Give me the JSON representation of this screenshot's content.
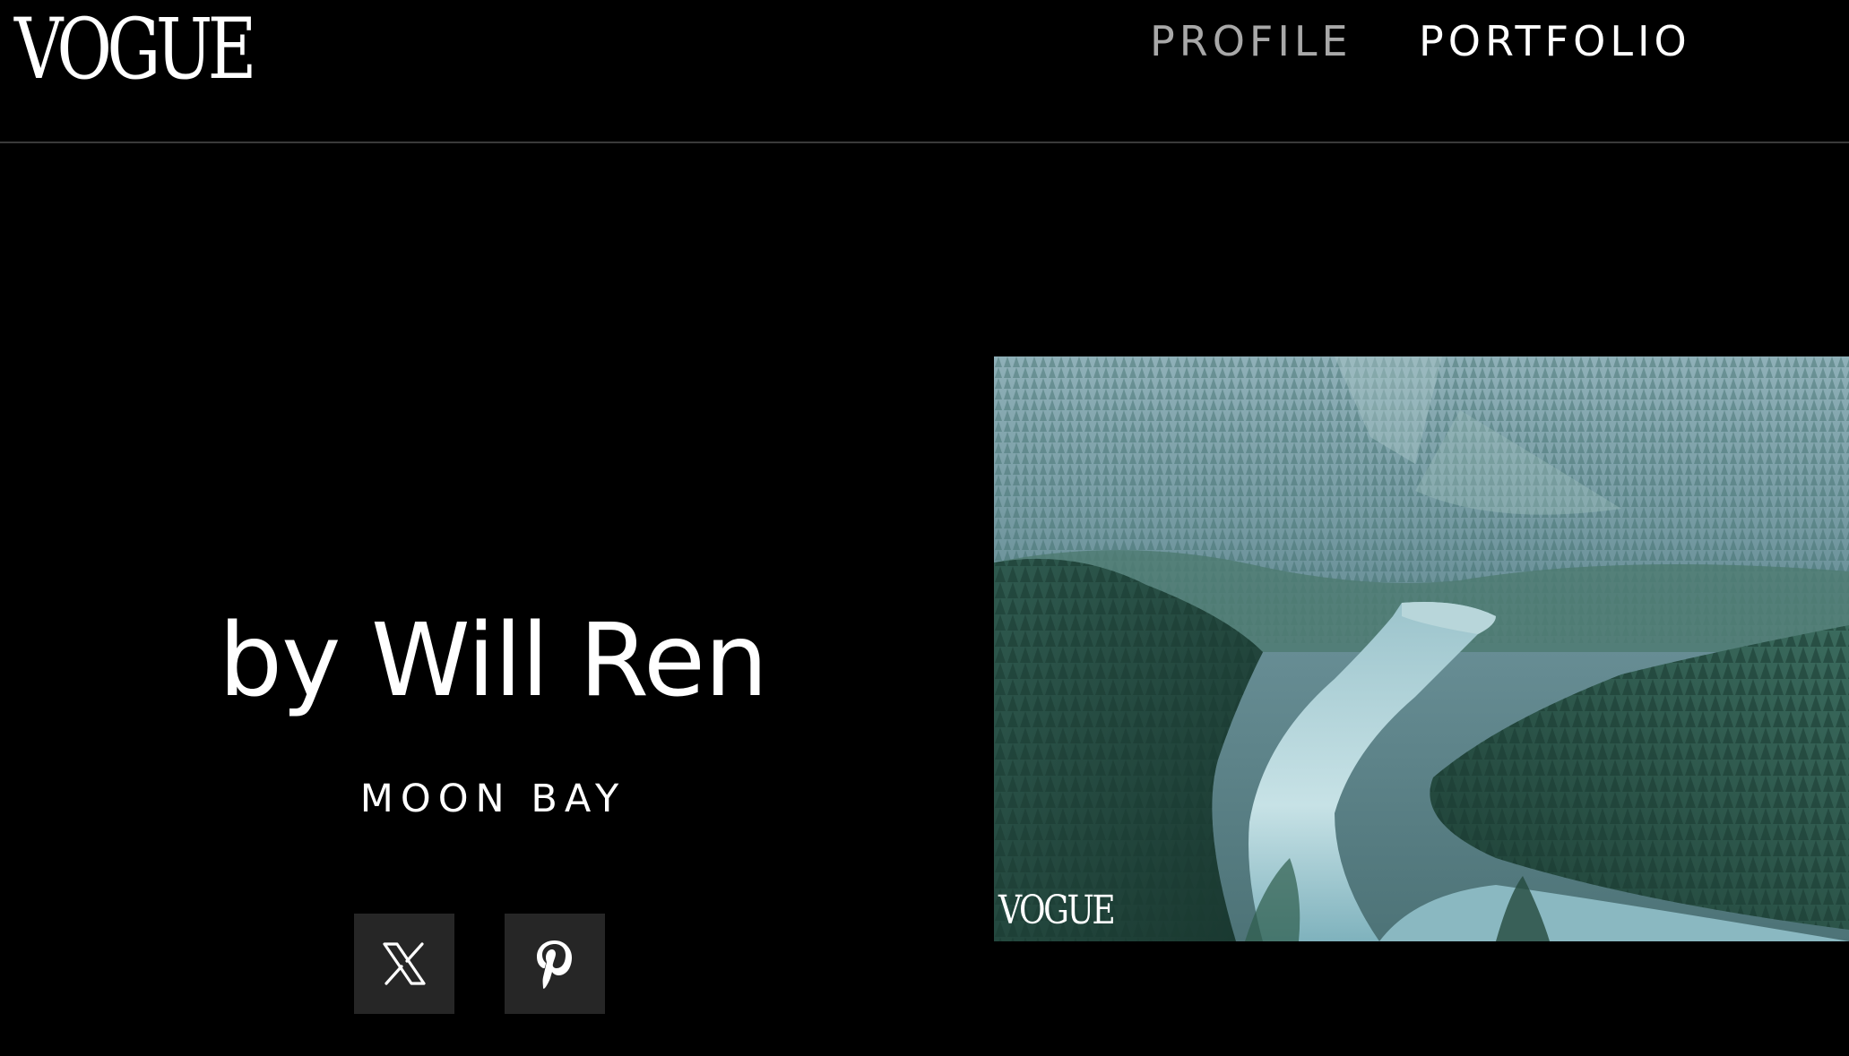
{
  "header": {
    "logo": "VOGUE",
    "nav": [
      {
        "label": "PROFILE",
        "active": false
      },
      {
        "label": "PORTFOLIO",
        "active": true
      }
    ]
  },
  "hero": {
    "byline": "by Will Ren",
    "title": "MOON BAY"
  },
  "social": [
    {
      "network": "X",
      "icon": "x-logo-icon"
    },
    {
      "network": "Pinterest",
      "icon": "pinterest-logo-icon"
    }
  ],
  "photo": {
    "description": "Aerial view of a winding turquoise river through a dense conifer forest valley",
    "watermark": "VOGUE"
  },
  "colors": {
    "background": "#000000",
    "nav_inactive": "#a8a8a8",
    "nav_active": "#ffffff",
    "social_button_bg": "#262626",
    "divider": "#3a3a3a"
  }
}
